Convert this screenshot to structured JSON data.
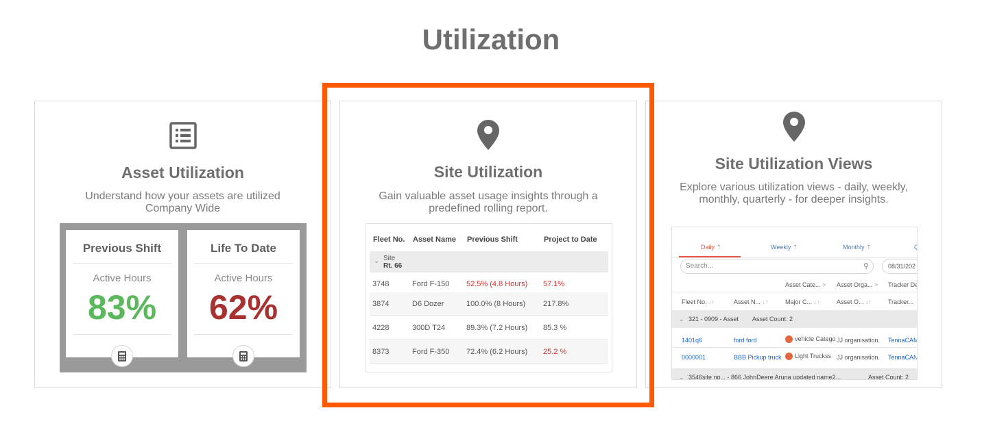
{
  "page": {
    "title": "Utilization"
  },
  "asset_card": {
    "title": "Asset Utilization",
    "description": "Understand how your assets are utilized Company Wide",
    "icon": "list-document-icon",
    "panels": [
      {
        "title": "Previous Shift",
        "label": "Active Hours",
        "value": "83%",
        "color": "#5cb85c"
      },
      {
        "title": "Life To Date",
        "label": "Active Hours",
        "value": "62%",
        "color": "#a83232"
      }
    ]
  },
  "site_card": {
    "title": "Site Utilization",
    "description": "Gain valuable asset usage insights through a predefined rolling report.",
    "icon": "map-pin-icon",
    "table": {
      "headers": [
        "Fleet No.",
        "Asset Name",
        "Previous Shift",
        "Project to Date"
      ],
      "site_label": "Site",
      "site_name": "Rt. 66",
      "rows": [
        {
          "fleet": "3748",
          "asset": "Ford F-150",
          "prev": "52.5% (4.8 Hours)",
          "ptd": "57.1%"
        },
        {
          "fleet": "3874",
          "asset": "D6 Dozer",
          "prev": "100.0% (8 Hours)",
          "ptd": "217.8%"
        },
        {
          "fleet": "4228",
          "asset": "300D T24",
          "prev": "89.3% (7.2 Hours)",
          "ptd": "85.3 %"
        },
        {
          "fleet": "8373",
          "asset": "Ford F-350",
          "prev": "72.4% (6.2 Hours)",
          "ptd": "25.2 %"
        }
      ]
    }
  },
  "views_card": {
    "title": "Site Utilization Views",
    "description": "Explore various utilization views - daily, weekly, monthly, quarterly - for deeper insights.",
    "icon": "map-pin-icon",
    "mini": {
      "tabs": [
        "Daily",
        "Weekly",
        "Monthly",
        "Q"
      ],
      "search_placeholder": "Search...",
      "date": "08/31/202",
      "group_headers": [
        "Asset Cate...",
        "Asset Orga...",
        "Tracker De"
      ],
      "columns": [
        "Fleet No.",
        "Asset N...",
        "Major C...",
        "Asset O...",
        "Tracker..."
      ],
      "group1": {
        "name": "321 - 0909 - Asset",
        "count": "Asset Count: 2"
      },
      "rows": [
        {
          "fleet": "1401q6",
          "asset": "ford ford",
          "category": "vehicle Catego",
          "org": "JJ organisation.",
          "tracker": "TennaCAM"
        },
        {
          "fleet": "0000001",
          "asset": "BBB Pickup truck",
          "category": "Light Truckss",
          "org": "JJ organisation.",
          "tracker": "TennaCAN"
        }
      ],
      "group2": {
        "name": "3546site no... - 866 JohnDeere Aruna updated name2...",
        "count": "Asset Count: 2"
      }
    }
  }
}
